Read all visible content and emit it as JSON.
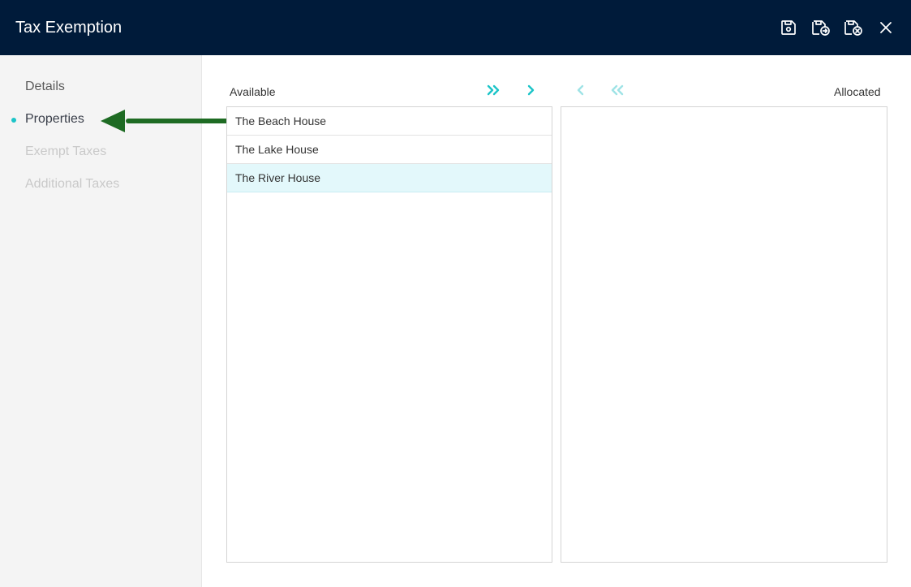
{
  "window": {
    "title": "Tax Exemption",
    "actions": [
      {
        "name": "save-icon"
      },
      {
        "name": "save-and-export-icon"
      },
      {
        "name": "save-and-close-icon"
      },
      {
        "name": "close-icon"
      }
    ]
  },
  "sidebar": {
    "items": [
      {
        "label": "Details",
        "state": "normal"
      },
      {
        "label": "Properties",
        "state": "active"
      },
      {
        "label": "Exempt Taxes",
        "state": "disabled"
      },
      {
        "label": "Additional Taxes",
        "state": "disabled"
      }
    ]
  },
  "annotation": {
    "color": "#1e6b23"
  },
  "available": {
    "label": "Available",
    "items": [
      {
        "label": "The Beach House",
        "highlighted": false
      },
      {
        "label": "The Lake House",
        "highlighted": false
      },
      {
        "label": "The River House",
        "highlighted": true
      }
    ]
  },
  "allocated": {
    "label": "Allocated",
    "items": []
  },
  "move_buttons": [
    {
      "name": "move-all-right-icon",
      "enabled": true
    },
    {
      "name": "move-right-icon",
      "enabled": true
    },
    {
      "name": "move-left-icon",
      "enabled": false
    },
    {
      "name": "move-all-left-icon",
      "enabled": false
    }
  ],
  "colors": {
    "header_bg": "#001b3a",
    "accent": "#1cc4c8",
    "accent_disabled": "#9fe3e6",
    "highlight_row": "#e3f8fb"
  }
}
